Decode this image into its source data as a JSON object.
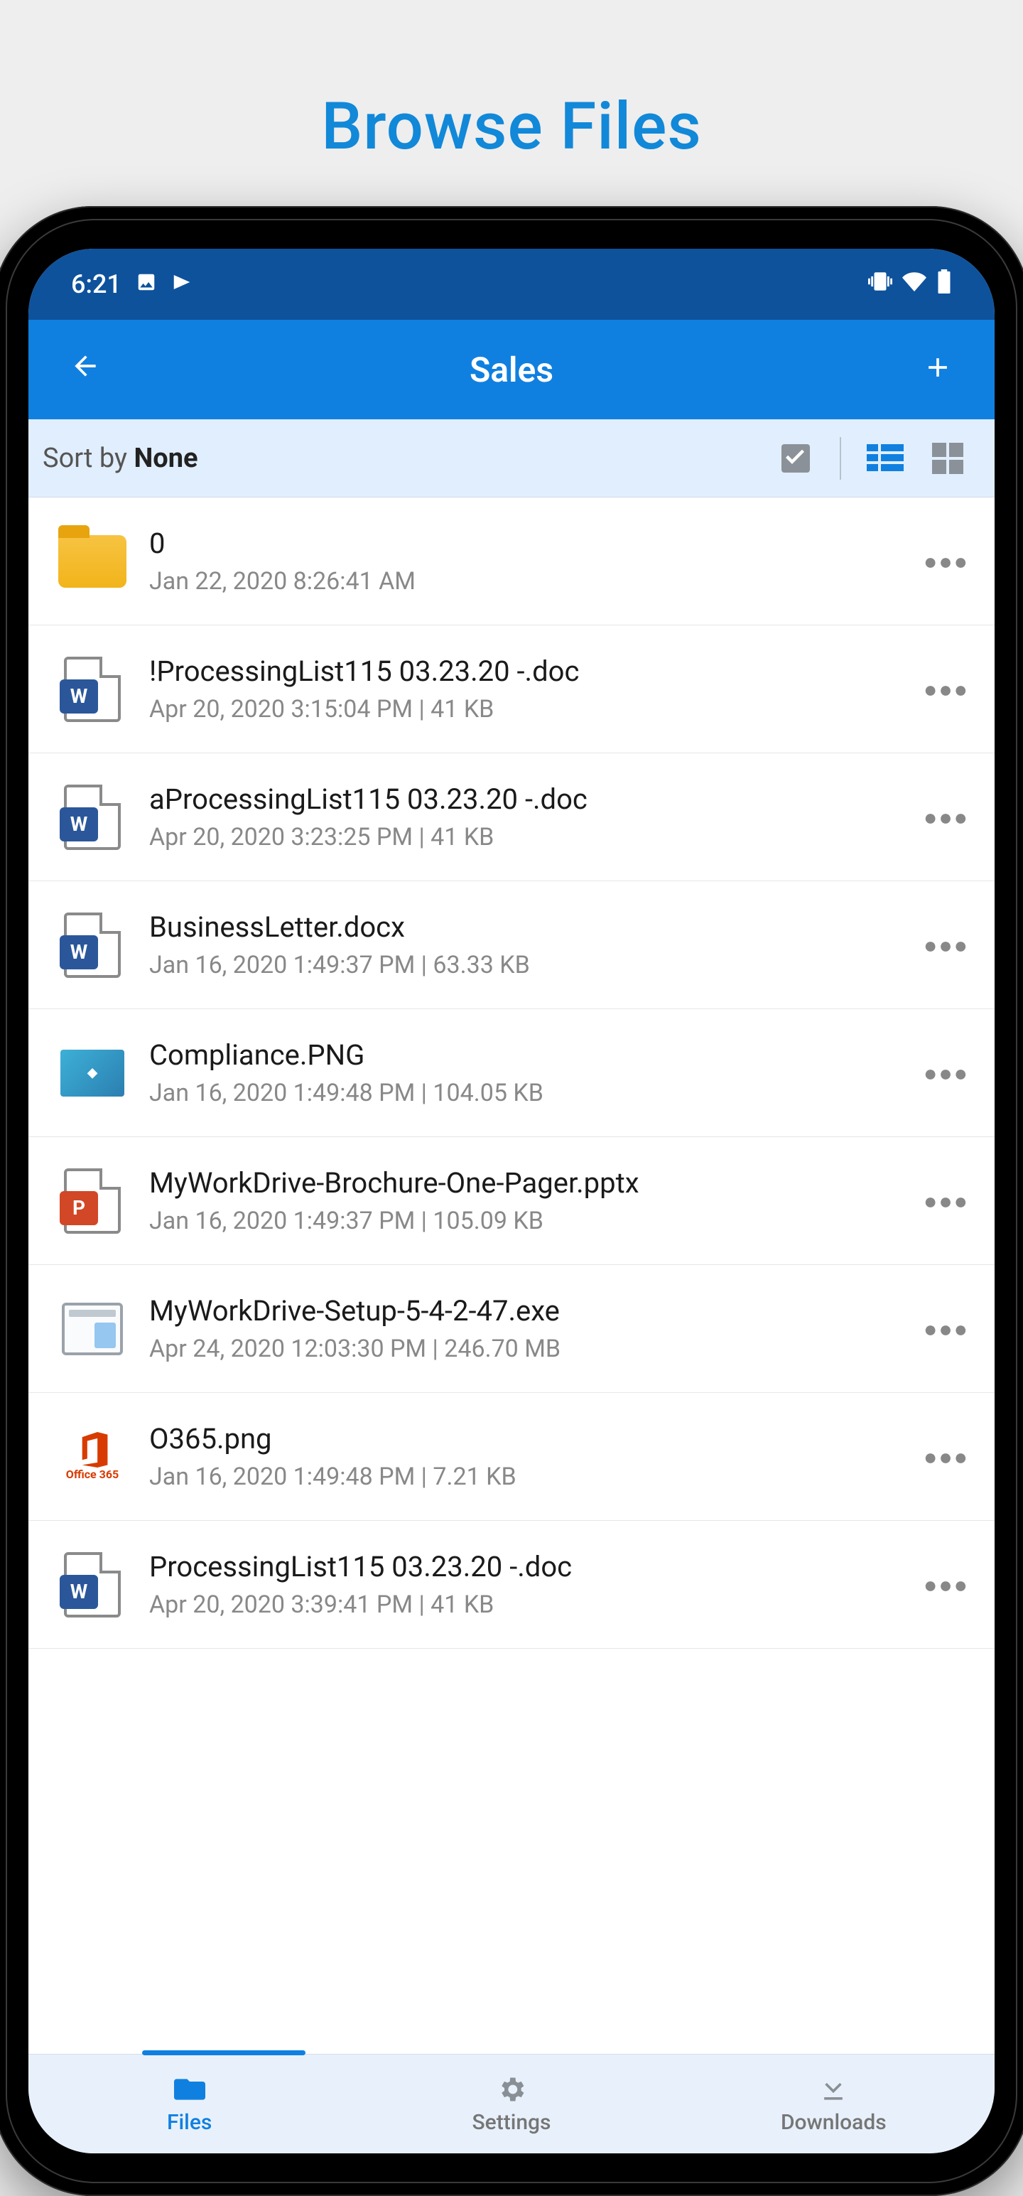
{
  "headline": "Browse Files",
  "status": {
    "time": "6:21"
  },
  "header": {
    "title": "Sales"
  },
  "sort": {
    "label": "Sort by ",
    "value": "None"
  },
  "files": [
    {
      "icon": "folder",
      "name": "0",
      "meta": "Jan 22, 2020 8:26:41 AM"
    },
    {
      "icon": "word",
      "name": "!ProcessingList115 03.23.20 -.doc",
      "meta": "Apr 20, 2020 3:15:04 PM | 41 KB"
    },
    {
      "icon": "word",
      "name": "aProcessingList115 03.23.20 -.doc",
      "meta": "Apr 20, 2020 3:23:25 PM | 41 KB"
    },
    {
      "icon": "word",
      "name": "BusinessLetter.docx",
      "meta": "Jan 16, 2020 1:49:37 PM | 63.33 KB"
    },
    {
      "icon": "image-compliance",
      "name": "Compliance.PNG",
      "meta": "Jan 16, 2020 1:49:48 PM | 104.05 KB"
    },
    {
      "icon": "ppt",
      "name": "MyWorkDrive-Brochure-One-Pager.pptx",
      "meta": "Jan 16, 2020 1:49:37 PM | 105.09 KB"
    },
    {
      "icon": "exe",
      "name": "MyWorkDrive-Setup-5-4-2-47.exe",
      "meta": "Apr 24, 2020 12:03:30 PM | 246.70 MB"
    },
    {
      "icon": "image-o365",
      "name": "O365.png",
      "meta": "Jan 16, 2020 1:49:48 PM | 7.21 KB"
    },
    {
      "icon": "word",
      "name": "ProcessingList115 03.23.20 -.doc",
      "meta": "Apr 20, 2020 3:39:41 PM | 41 KB"
    }
  ],
  "o365_tag": "Office 365",
  "nav": {
    "files": "Files",
    "settings": "Settings",
    "downloads": "Downloads"
  }
}
